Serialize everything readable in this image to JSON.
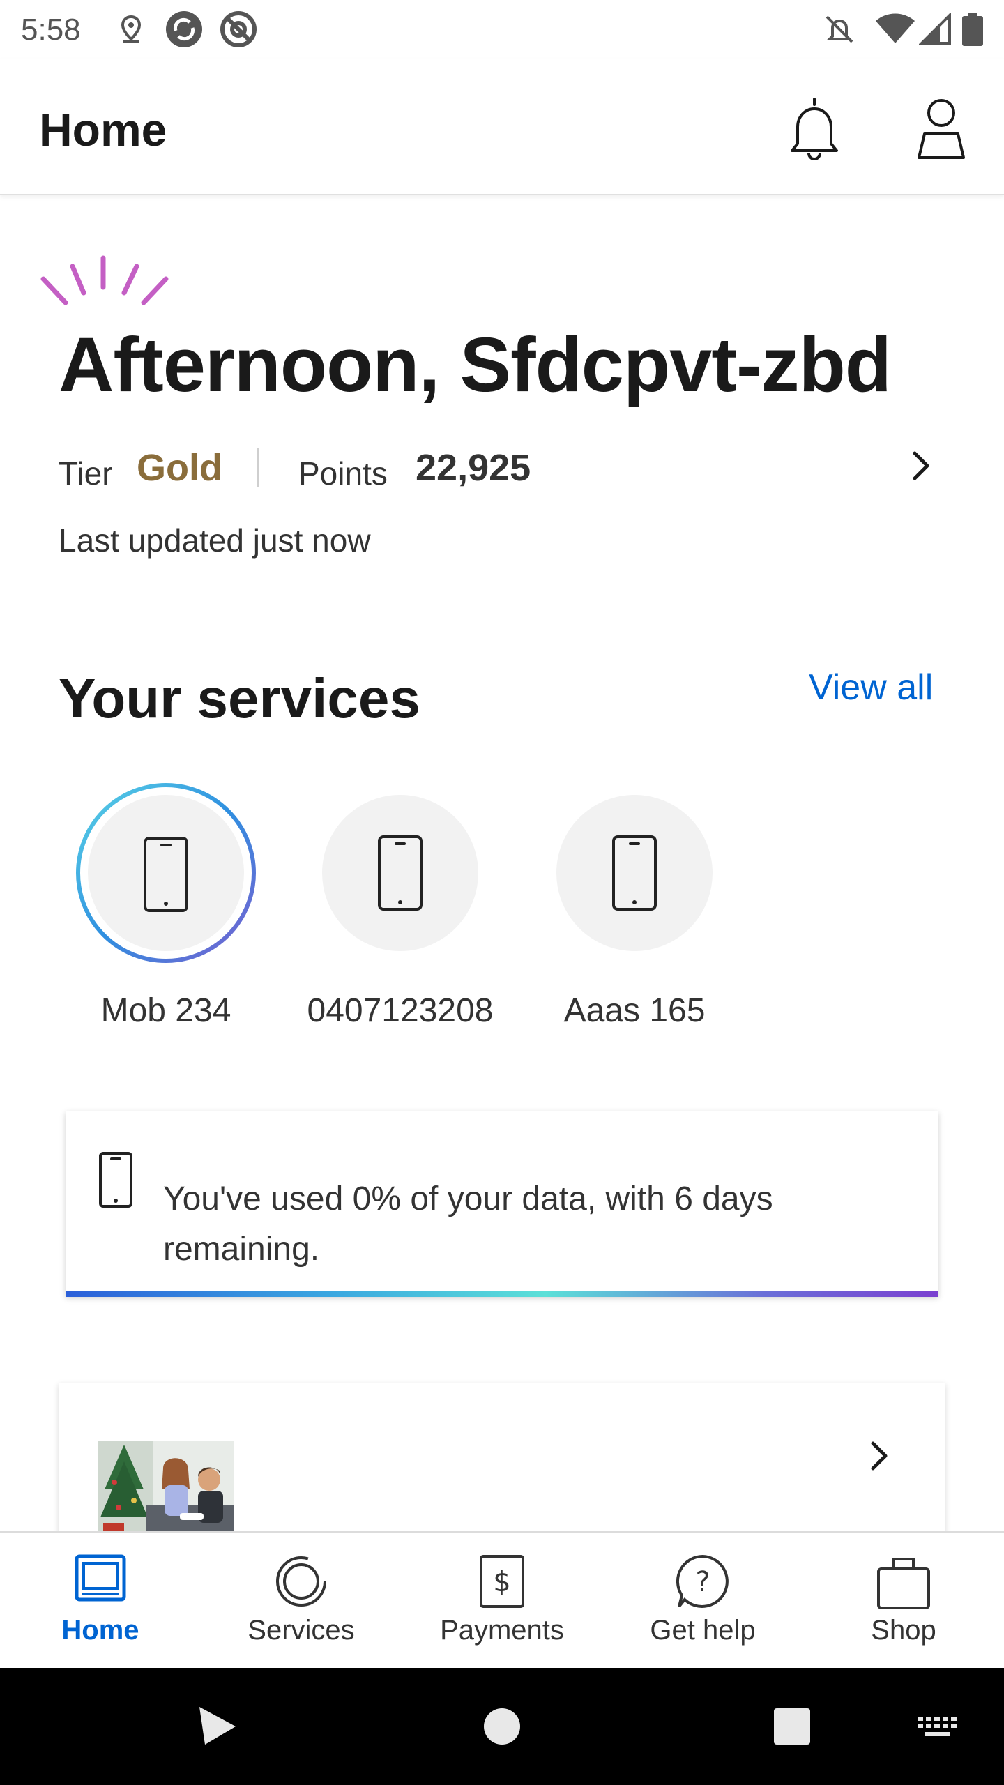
{
  "status_bar": {
    "time": "5:58",
    "left_icons": [
      "location-icon",
      "sync-icon",
      "at-icon"
    ],
    "right_icons": [
      "notifications-off-icon",
      "wifi-icon",
      "signal-icon",
      "battery-icon"
    ]
  },
  "app_bar": {
    "title": "Home",
    "actions": [
      "bell-icon",
      "profile-icon"
    ]
  },
  "greeting": {
    "text": "Afternoon, Sfdcpvt-zbd",
    "tier_label": "Tier",
    "tier_value": "Gold",
    "points_label": "Points",
    "points_value": "22,925",
    "last_updated": "Last updated just now",
    "tier_color": "#8a6d3b",
    "sparkle_color": "#c45fc4"
  },
  "services": {
    "title": "Your services",
    "view_all": "View all",
    "items": [
      {
        "label": "Mob 234",
        "icon": "phone-icon",
        "selected": true
      },
      {
        "label": "0407123208",
        "icon": "phone-icon",
        "selected": false
      },
      {
        "label": "Aaas 165",
        "icon": "phone-icon",
        "selected": false
      }
    ]
  },
  "data_card": {
    "icon": "phone-icon",
    "text": "You've used 0% of your data, with 6 days remaining.",
    "usage_percent": 0
  },
  "promo_card": {
    "image": "family-photo",
    "icon": "chevron-right-icon"
  },
  "bottom_nav": {
    "items": [
      {
        "label": "Home",
        "icon": "home-icon",
        "active": true
      },
      {
        "label": "Services",
        "icon": "services-icon",
        "active": false
      },
      {
        "label": "Payments",
        "icon": "payments-icon",
        "active": false
      },
      {
        "label": "Get help",
        "icon": "help-icon",
        "active": false
      },
      {
        "label": "Shop",
        "icon": "shop-icon",
        "active": false
      }
    ]
  },
  "colors": {
    "accent": "#0064d2",
    "text": "#1a1a1a"
  }
}
